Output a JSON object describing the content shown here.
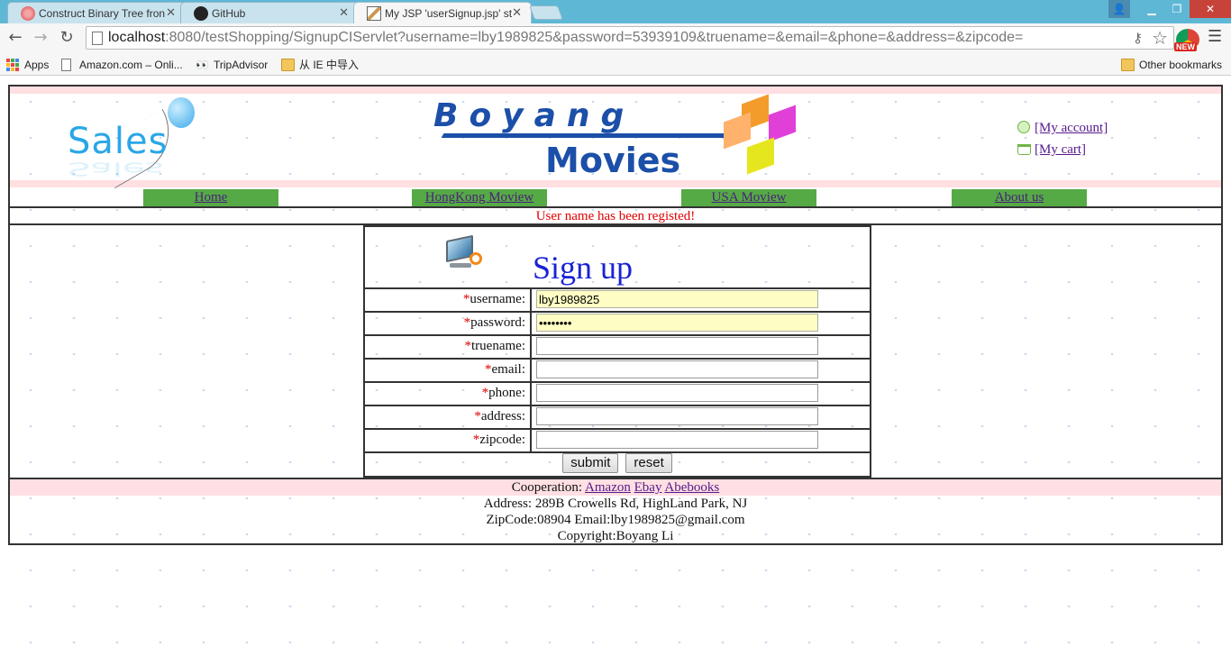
{
  "browser": {
    "tabs": [
      {
        "title": "Construct Binary Tree fron",
        "icon": "leetcode-icon",
        "active": false
      },
      {
        "title": "GitHub",
        "icon": "github-icon",
        "active": false
      },
      {
        "title": "My JSP 'userSignup.jsp' st",
        "icon": "jsp-icon",
        "active": true
      }
    ],
    "url_host": "localhost",
    "url_rest": ":8080/testShopping/SignupCIServlet?username=lby1989825&password=53939109&truename=&email=&phone=&address=&zipcode=",
    "ext_badge": "NEW",
    "bookmarks": [
      {
        "label": "Apps",
        "icon": "apps-icon"
      },
      {
        "label": "Amazon.com – Onli...",
        "icon": "page-icon"
      },
      {
        "label": "TripAdvisor",
        "icon": "tripadvisor-icon"
      },
      {
        "label": "从 IE 中导入",
        "icon": "folder-icon"
      }
    ],
    "other_bookmarks": "Other bookmarks"
  },
  "site": {
    "logo_left": "Sales",
    "logo_main_top": "Boyang",
    "logo_main_bottom": "Movies",
    "account_link": "[My account]",
    "cart_link": "[My cart]",
    "nav": [
      "Home",
      "HongKong Moview",
      "USA Moview",
      "About us"
    ],
    "message": "User name has been registed!",
    "message_color": "#e00000"
  },
  "form": {
    "title": "Sign up",
    "required_mark": "*",
    "fields": [
      {
        "label": "username:",
        "value": "lby1989825",
        "type": "text"
      },
      {
        "label": "password:",
        "value": "53939109",
        "type": "password"
      },
      {
        "label": "truename:",
        "value": "",
        "type": "text"
      },
      {
        "label": "email:",
        "value": "",
        "type": "text"
      },
      {
        "label": "phone:",
        "value": "",
        "type": "text"
      },
      {
        "label": "address:",
        "value": "",
        "type": "text"
      },
      {
        "label": "zipcode:",
        "value": "",
        "type": "text"
      }
    ],
    "submit_label": "submit",
    "reset_label": "reset"
  },
  "footer": {
    "cooperation_label": "Cooperation:",
    "partners": [
      "Amazon",
      "Ebay",
      "Abebooks"
    ],
    "address": "Address: 289B Crowells Rd, HighLand Park, NJ",
    "contact": "ZipCode:08904 Email:lby1989825@gmail.com",
    "copyright": "Copyright:Boyang Li"
  }
}
